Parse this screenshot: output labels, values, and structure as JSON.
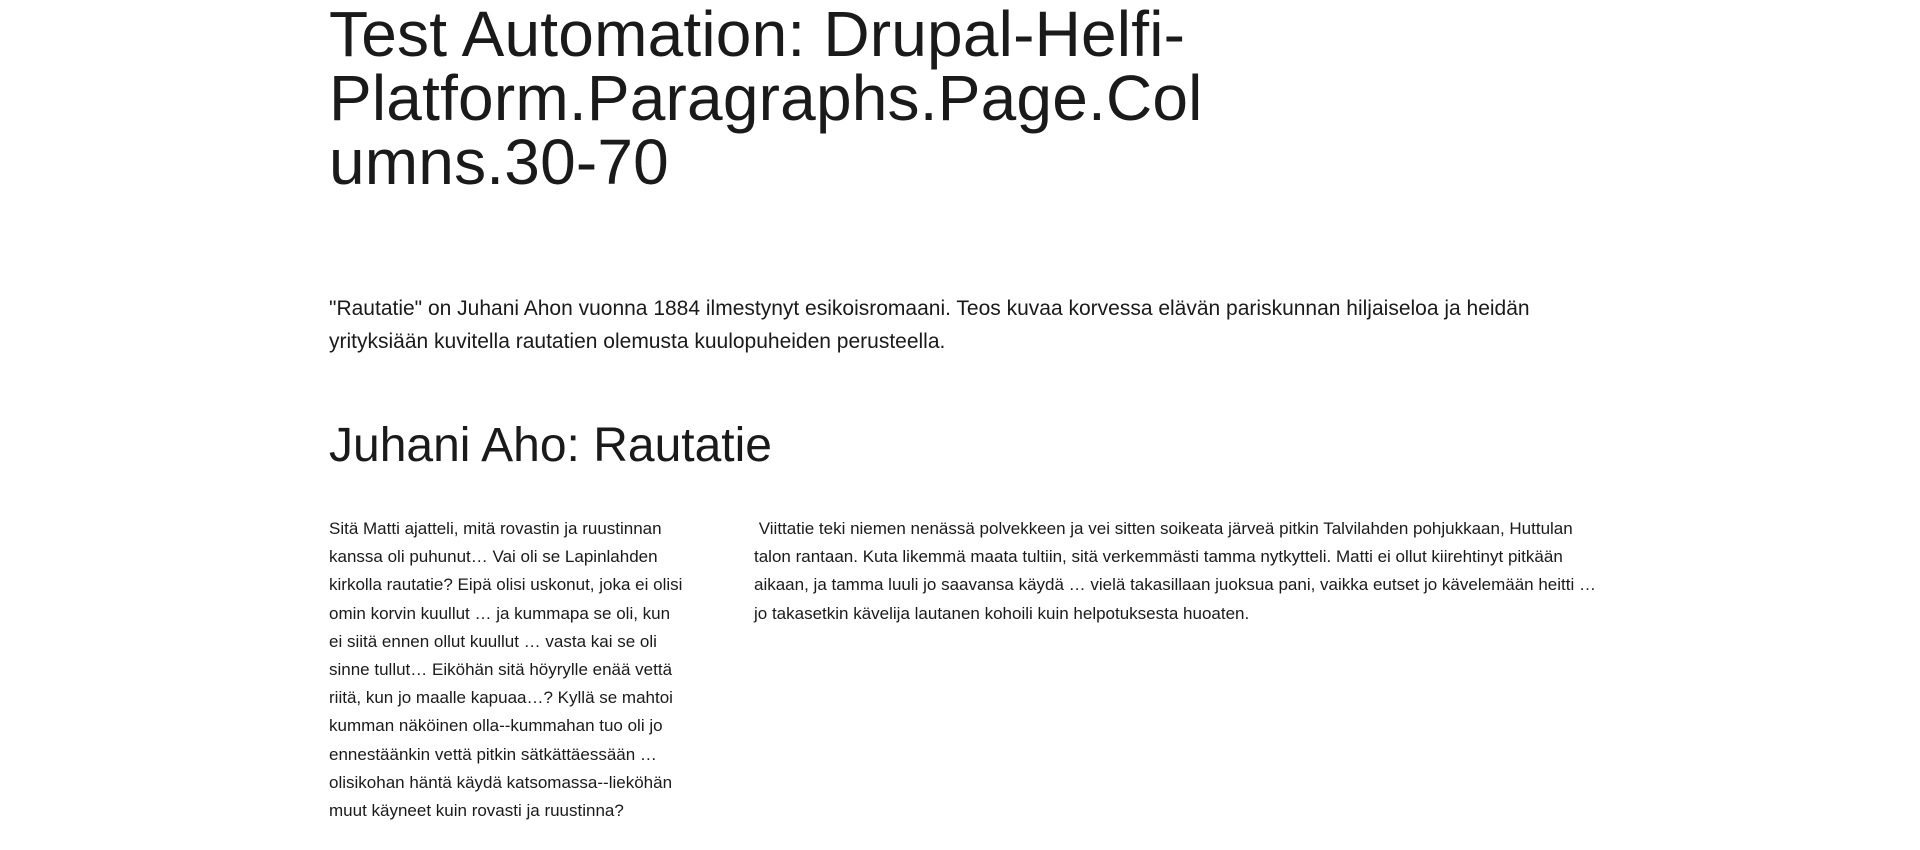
{
  "page": {
    "title": "Test Automation: Drupal-Helfi-Platform.Paragraphs.Page.Columns.30-70",
    "lead": "\"Rautatie\" on Juhani Ahon vuonna 1884 ilmestynyt esikoisromaani. Teos kuvaa korvessa elävän pariskunnan hiljaiseloa ja heidän yrityksiään kuvitella rautatien olemusta kuulopuheiden perusteella.",
    "section_title": "Juhani Aho: Rautatie"
  },
  "columns": {
    "left": "Sitä Matti ajatteli, mitä rovastin ja ruustinnan kanssa oli puhunut… Vai oli se Lapinlahden kirkolla rautatie? Eipä olisi uskonut, joka ei olisi omin korvin kuullut … ja kummapa se oli, kun ei siitä ennen ollut kuullut … vasta kai se oli sinne tullut… Eiköhän sitä höyrylle enää vettä riitä, kun jo maalle kapuaa…? Kyllä se mahtoi kumman näköinen olla--kummahan tuo oli jo ennestäänkin vettä pitkin sätkättäessään … olisikohan häntä käydä katsomassa--lieköhän muut käyneet kuin rovasti ja ruustinna?",
    "right": " Viittatie teki niemen nenässä polvekkeen ja vei sitten soikeata järveä pitkin Talvilahden pohjukkaan, Huttulan talon rantaan. Kuta likemmä maata tultiin, sitä verkemmästi tamma nytkytteli. Matti ei ollut kiirehtinyt pitkään aikaan, ja tamma luuli jo saavansa käydä … vielä takasillaan juoksua pani, vaikka eutset jo kävelemään heitti … jo takasetkin kävelija lautanen kohoili kuin helpotuksesta huoaten."
  }
}
